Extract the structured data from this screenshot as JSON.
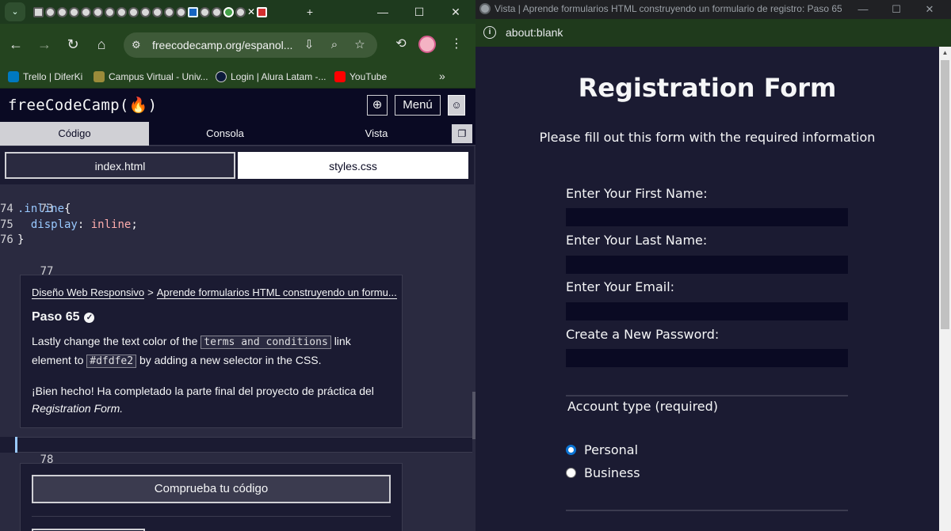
{
  "left_browser": {
    "tab_strip_close": "✕",
    "window_controls": {
      "minimize": "—",
      "maximize": "☐",
      "close": "✕"
    },
    "new_tab": "+",
    "tab_dropdown": "⌄",
    "address": {
      "url": "freecodecamp.org/espanol..."
    },
    "bookmarks": [
      {
        "label": "Trello | DiferKi",
        "color": "#0079bf"
      },
      {
        "label": "Campus Virtual - Univ...",
        "color": "#9b8b3a"
      },
      {
        "label": "Login | Alura Latam -...",
        "color": "#0c1a3a"
      },
      {
        "label": "YouTube",
        "color": "#ff0000"
      }
    ],
    "bookmarks_more": "»"
  },
  "fcc": {
    "logo": "freeCodeCamp(🔥)",
    "menu_label": "Menú",
    "pane_tabs": [
      "Código",
      "Consola",
      "Vista"
    ],
    "file_tabs": [
      "index.html",
      "styles.css"
    ],
    "code": {
      "line73": "73",
      "line74_num": "74",
      "line74_selector": ".inline",
      "line74_brace": "{",
      "line75_num": "75",
      "line75_prop": "display",
      "line75_colon": ": ",
      "line75_value": "inline",
      "line75_semi": ";",
      "line76_num": "76",
      "line76_brace": "}",
      "line77": "77",
      "line78": "78"
    },
    "description": {
      "crumb1": "Diseño Web Responsivo",
      "crumb_sep": ">",
      "crumb2": "Aprende formularios HTML construyendo un formu...",
      "step": "Paso 65",
      "text_a": "Lastly change the text color of the",
      "code_a": "terms and conditions",
      "text_b": "link element to",
      "code_b": "#dfdfe2",
      "text_c": "by adding a new selector in the CSS.",
      "text_d": "¡Bien hecho! Ha completado la parte final del proyecto de práctica del",
      "text_e": "Registration Form."
    },
    "check_button": "Comprueba tu código"
  },
  "right_browser": {
    "title": "Vista | Aprende formularios HTML construyendo un formulario de registro: Paso 65 | fre...",
    "window_controls": {
      "minimize": "—",
      "maximize": "☐",
      "close": "✕"
    },
    "url": "about:blank",
    "form": {
      "heading": "Registration Form",
      "subtitle": "Please fill out this form with the required information",
      "fields": [
        "Enter Your First Name:",
        "Enter Your Last Name:",
        "Enter Your Email:",
        "Create a New Password:"
      ],
      "legend": "Account type (required)",
      "radios": [
        {
          "label": "Personal",
          "checked": true
        },
        {
          "label": "Business",
          "checked": false
        }
      ]
    }
  }
}
